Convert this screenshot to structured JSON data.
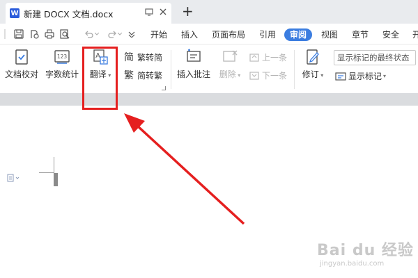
{
  "window": {
    "app_icon_letter": "W",
    "doc_tab_title": "新建 DOCX 文档.docx"
  },
  "menu": {
    "items": [
      "开始",
      "插入",
      "页面布局",
      "引用",
      "审阅",
      "视图",
      "章节",
      "安全",
      "开"
    ],
    "active": "审阅"
  },
  "ribbon": {
    "proofread": "文档校对",
    "word_count": "字数统计",
    "word_count_icon_text": "123",
    "translate": "翻译",
    "trad_to_simp_prefix": "简",
    "trad_to_simp": "繁转简",
    "simp_to_trad_prefix": "繁",
    "simp_to_trad": "简转繁",
    "insert_comment": "插入批注",
    "delete": "删除",
    "previous": "上一条",
    "next": "下一条",
    "revise": "修订",
    "show_markup_dropdown": "显示标记的最终状态",
    "show_markup": "显示标记"
  },
  "watermark": {
    "main": "Bai du 经验",
    "sub": "jingyan.baidu.com"
  },
  "colors": {
    "accent": "#3b7de0",
    "highlight": "#e51f1f"
  }
}
